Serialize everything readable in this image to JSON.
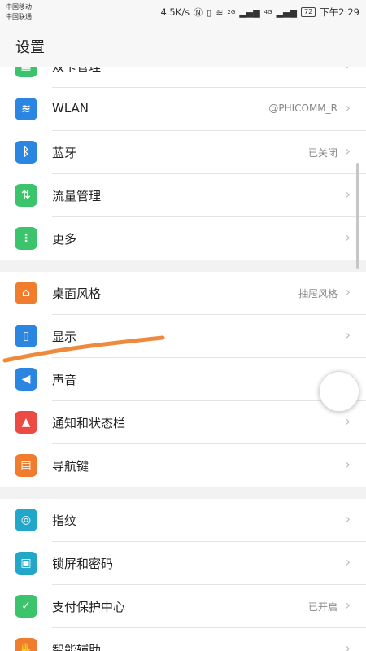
{
  "status": {
    "carrier1": "中国移动",
    "carrier2": "中国联通",
    "speed": "4.5K/s",
    "sim1": "2G",
    "sim2": "4G",
    "battery": "72",
    "time": "下午2:29"
  },
  "header": {
    "title": "设置"
  },
  "colors": {
    "accent_stroke": "#ef8a3c"
  },
  "groups": [
    {
      "items": [
        {
          "name": "dual-card",
          "label": "双卡管理",
          "value": "",
          "icon": "sim-card-icon",
          "color": "#3bc46b",
          "glyph": "▦"
        },
        {
          "name": "wlan",
          "label": "WLAN",
          "value": "@PHICOMM_R",
          "icon": "wifi-icon",
          "color": "#2a86e0",
          "glyph": "≋"
        },
        {
          "name": "bluetooth",
          "label": "蓝牙",
          "value": "已关闭",
          "icon": "bluetooth-icon",
          "color": "#2a86e0",
          "glyph": "ᛒ"
        },
        {
          "name": "data-usage",
          "label": "流量管理",
          "value": "",
          "icon": "data-usage-icon",
          "color": "#3bc46b",
          "glyph": "⇅"
        },
        {
          "name": "more",
          "label": "更多",
          "value": "",
          "icon": "more-icon",
          "color": "#3bc46b",
          "glyph": "⋮"
        }
      ]
    },
    {
      "items": [
        {
          "name": "home-style",
          "label": "桌面风格",
          "value": "抽屉风格",
          "icon": "home-icon",
          "color": "#f07d2e",
          "glyph": "⌂"
        },
        {
          "name": "display",
          "label": "显示",
          "value": "",
          "icon": "display-icon",
          "color": "#2a86e0",
          "glyph": "▯"
        },
        {
          "name": "sound",
          "label": "声音",
          "value": "",
          "icon": "speaker-icon",
          "color": "#2a86e0",
          "glyph": "◀"
        },
        {
          "name": "notifications",
          "label": "通知和状态栏",
          "value": "",
          "icon": "bell-icon",
          "color": "#ec4b43",
          "glyph": "▲"
        },
        {
          "name": "nav-keys",
          "label": "导航键",
          "value": "",
          "icon": "nav-keys-icon",
          "color": "#f07d2e",
          "glyph": "▤"
        }
      ]
    },
    {
      "items": [
        {
          "name": "fingerprint",
          "label": "指纹",
          "value": "",
          "icon": "fingerprint-icon",
          "color": "#23a7c9",
          "glyph": "◎"
        },
        {
          "name": "lockscreen",
          "label": "锁屏和密码",
          "value": "",
          "icon": "lock-icon",
          "color": "#23a7c9",
          "glyph": "▣"
        },
        {
          "name": "payment-protection",
          "label": "支付保护中心",
          "value": "已开启",
          "icon": "shield-icon",
          "color": "#3bc46b",
          "glyph": "✓"
        },
        {
          "name": "accessibility",
          "label": "智能辅助",
          "value": "",
          "icon": "hand-icon",
          "color": "#f07d2e",
          "glyph": "✋"
        }
      ]
    }
  ]
}
